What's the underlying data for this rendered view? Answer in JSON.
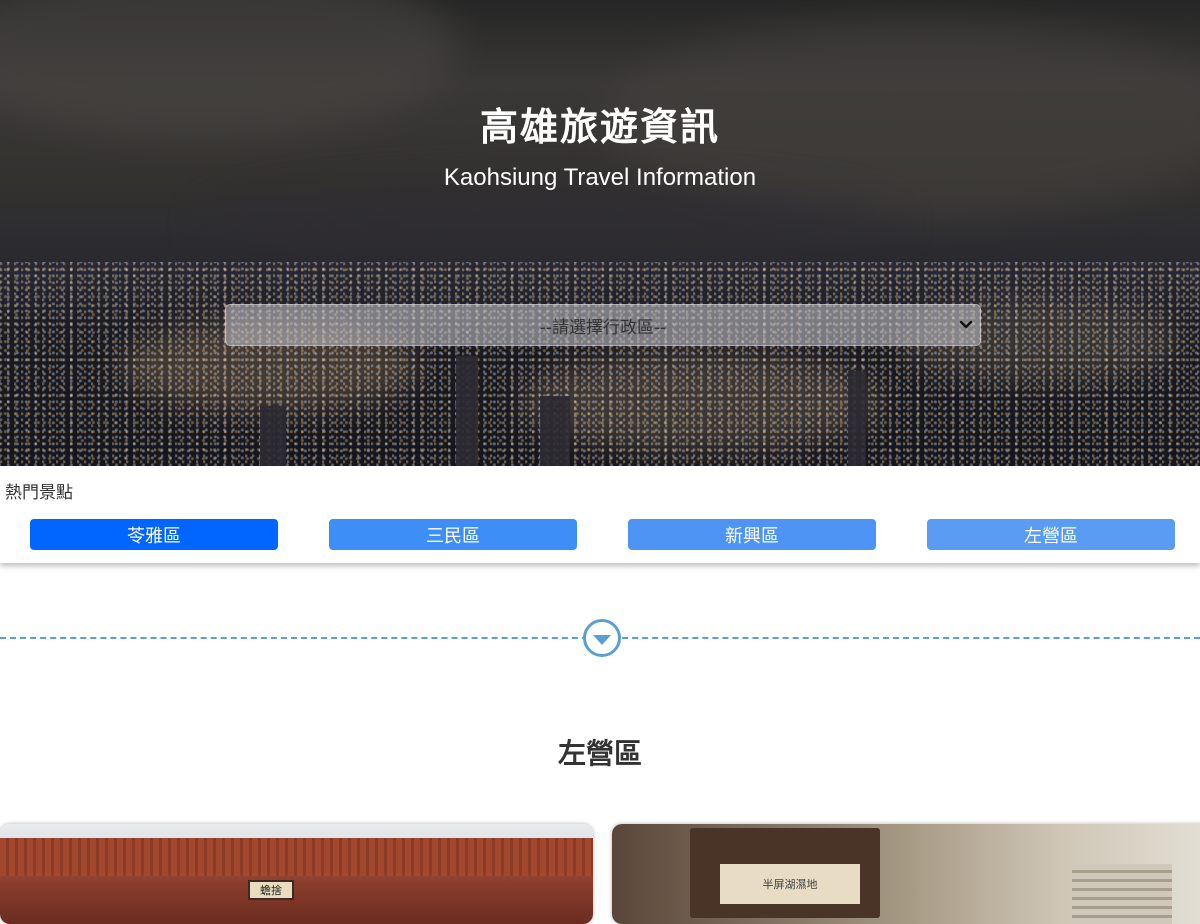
{
  "header": {
    "title": "高雄旅遊資訊",
    "subtitle": "Kaohsiung Travel Information"
  },
  "district_select": {
    "selected": "--請選擇行政區--"
  },
  "hot_spots": {
    "label": "熱門景點",
    "buttons": [
      {
        "label": "苓雅區",
        "color": "#0066ff"
      },
      {
        "label": "三民區",
        "color": "#3e8ef7"
      },
      {
        "label": "新興區",
        "color": "#4d94f5"
      },
      {
        "label": "左營區",
        "color": "#5a9cf3"
      }
    ]
  },
  "section": {
    "title": "左營區"
  },
  "cards": [
    {
      "plaque_text": "蟾捨"
    },
    {
      "sign_text": "半屏湖濕地"
    }
  ],
  "colors": {
    "divider": "#5b9fd0",
    "accent": "#0066ff"
  }
}
